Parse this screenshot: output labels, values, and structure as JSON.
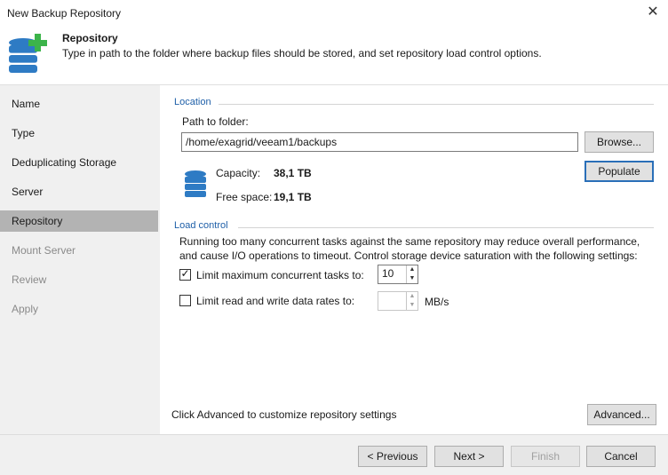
{
  "window": {
    "title": "New Backup Repository",
    "close_glyph": "✕"
  },
  "header": {
    "icon": "database-add-icon",
    "title": "Repository",
    "description": "Type in path to the folder where backup files should be stored, and set repository load control options."
  },
  "sidebar": {
    "steps": [
      {
        "label": "Name",
        "state": "normal"
      },
      {
        "label": "Type",
        "state": "normal"
      },
      {
        "label": "Deduplicating Storage",
        "state": "normal"
      },
      {
        "label": "Server",
        "state": "normal"
      },
      {
        "label": "Repository",
        "state": "active"
      },
      {
        "label": "Mount Server",
        "state": "disabled"
      },
      {
        "label": "Review",
        "state": "disabled"
      },
      {
        "label": "Apply",
        "state": "disabled"
      }
    ]
  },
  "location": {
    "section_title": "Location",
    "path_label": "Path to folder:",
    "path_value": "/home/exagrid/veeam1/backups",
    "browse_label": "Browse...",
    "capacity_label": "Capacity:",
    "capacity_value": "38,1 TB",
    "free_label": "Free space:",
    "free_value": "19,1 TB",
    "populate_label": "Populate",
    "storage_icon": "database-icon"
  },
  "load_control": {
    "section_title": "Load control",
    "description_line1": "Running too many concurrent tasks against the same repository may reduce overall performance,",
    "description_line2": "and cause I/O operations to timeout. Control storage device saturation with the following settings:",
    "limit_tasks_label": "Limit maximum concurrent tasks to:",
    "limit_tasks_checked": true,
    "limit_tasks_value": "10",
    "limit_rate_label": "Limit read and write data rates to:",
    "limit_rate_checked": false,
    "limit_rate_value": "",
    "rate_unit": "MB/s",
    "check_glyph": "✓",
    "up_glyph": "▲",
    "down_glyph": "▼"
  },
  "advanced": {
    "hint": "Click Advanced to customize repository settings",
    "button_label": "Advanced..."
  },
  "footer": {
    "previous_label": "< Previous",
    "next_label": "Next >",
    "finish_label": "Finish",
    "cancel_label": "Cancel"
  },
  "colors": {
    "accent": "#1e5fa8",
    "icon_blue": "#2e7bc4",
    "plus_green": "#3cb44a",
    "active_step": "#b3b3b3"
  }
}
